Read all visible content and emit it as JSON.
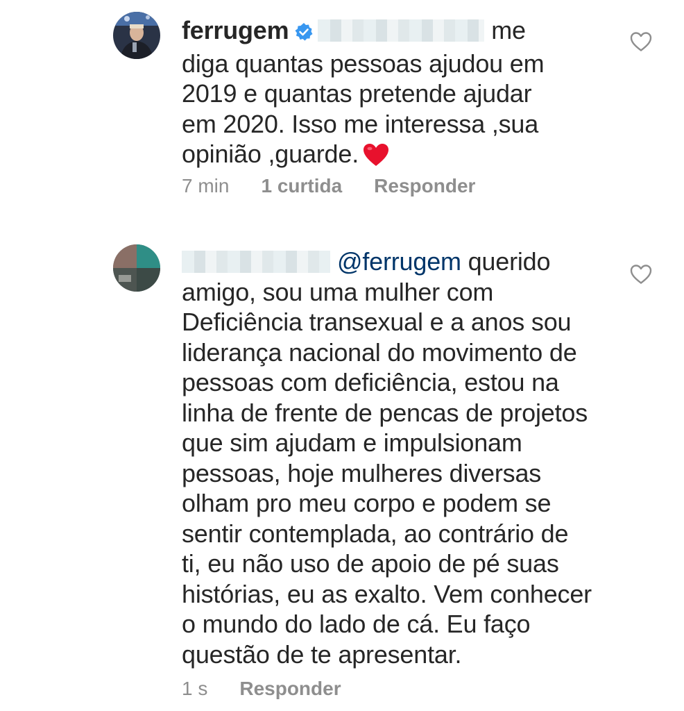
{
  "comments": [
    {
      "username": "ferrugem",
      "verified": true,
      "text_after_redaction": " me",
      "lines": [
        "diga quantas pessoas ajudou em",
        "2019 e quantas pretende ajudar",
        "em 2020. Isso me interessa ,sua",
        "opinião ,guarde."
      ],
      "emoji": "heart",
      "time": "7 min",
      "likes": "1 curtida",
      "reply_label": "Responder"
    },
    {
      "mention": "@ferrugem",
      "first_line_rest": " querido",
      "lines": [
        "amigo, sou uma mulher com",
        "Deficiência transexual e a anos sou",
        "liderança nacional do movimento de",
        "pessoas com deficiência, estou na",
        "linha de frente de pencas de projetos",
        "que sim ajudam e impulsionam",
        "pessoas, hoje mulheres diversas",
        "olham pro meu corpo e podem se",
        "sentir contemplada, ao contrário de",
        "ti, eu não uso de apoio de pé suas",
        "histórias, eu as exalto. Vem conhecer",
        "o mundo do lado de cá. Eu faço",
        "questão de te apresentar."
      ],
      "time": "1 s",
      "reply_label": "Responder"
    }
  ],
  "icons": {
    "like": "heart-outline-icon",
    "verified": "verified-badge-icon"
  },
  "colors": {
    "text": "#262626",
    "meta": "#8e8e8e",
    "mention": "#003569",
    "verified": "#3897f0",
    "heart": "#e8112d"
  }
}
